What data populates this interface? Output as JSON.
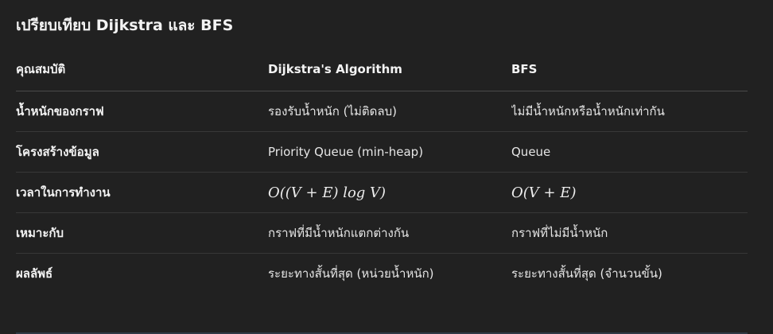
{
  "heading": "เปรียบเทียบ Dijkstra และ BFS",
  "table": {
    "headers": [
      "คุณสมบัติ",
      "Dijkstra's Algorithm",
      "BFS"
    ],
    "rows": [
      [
        "น้ำหนักของกราฟ",
        "รองรับน้ำหนัก (ไม่ติดลบ)",
        "ไม่มีน้ำหนักหรือน้ำหนักเท่ากัน"
      ],
      [
        "โครงสร้างข้อมูล",
        "Priority Queue (min-heap)",
        "Queue"
      ],
      [
        "เวลาในการทำงาน",
        "O((V + E) log V)",
        "O(V + E)"
      ],
      [
        "เหมาะกับ",
        "กราฟที่มีน้ำหนักแตกต่างกัน",
        "กราฟที่ไม่มีน้ำหนัก"
      ],
      [
        "ผลลัพธ์",
        "ระยะทางสั้นที่สุด (หน่วยน้ำหนัก)",
        "ระยะทางสั้นที่สุด (จำนวนขั้น)"
      ]
    ]
  }
}
